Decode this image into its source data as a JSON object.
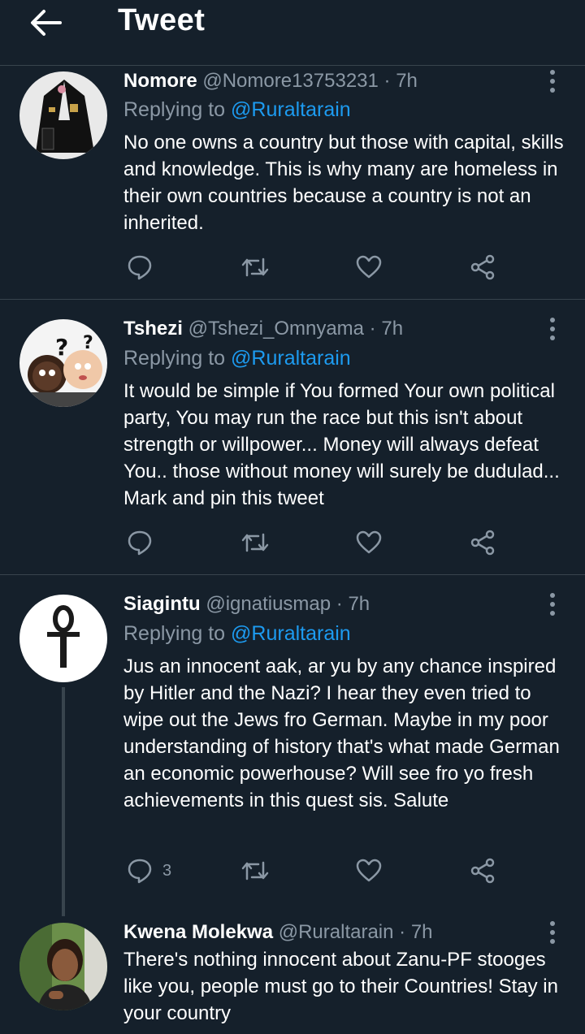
{
  "header": {
    "title": "Tweet"
  },
  "tweets": [
    {
      "name": "Nomore",
      "handle": "@Nomore13753231",
      "time": "7h",
      "replying_prefix": "Replying to ",
      "replying_to": "@Ruraltarain",
      "text": "No one owns a country but those with capital, skills and knowledge. This is why many are homeless in their own countries because a country is not an inherited.",
      "reply_count": ""
    },
    {
      "name": "Tshezi",
      "handle": "@Tshezi_Omnyama",
      "time": "7h",
      "replying_prefix": "Replying to ",
      "replying_to": "@Ruraltarain",
      "text": "It would be simple if You formed Your own political party, You may run the race but this isn't about strength or willpower... Money will always defeat You.. those without money will surely be dudulad... Mark and pin this tweet",
      "reply_count": ""
    },
    {
      "name": "Siagintu",
      "handle": "@ignatiusmap",
      "time": "7h",
      "replying_prefix": "Replying to ",
      "replying_to": "@Ruraltarain",
      "text": "Jus an innocent aak, ar yu by any chance inspired by Hitler and the Nazi? I hear they even tried to wipe out the Jews fro German. Maybe in my poor understanding of history that's what made German an economic powerhouse? Will see fro yo fresh achievements in this quest sis. Salute",
      "reply_count": "3"
    },
    {
      "name": "Kwena Molekwa",
      "handle": "@Ruraltarain",
      "time": "7h",
      "text": "There's nothing innocent about Zanu-PF stooges like you, people must go to their Countries! Stay in your country"
    }
  ],
  "separator": " · ",
  "colors": {
    "background": "#15202b",
    "divider": "#38444d",
    "secondary_text": "#8b98a5",
    "accent": "#1d9bf0"
  },
  "icons": [
    "back-arrow-icon",
    "more-vertical-icon",
    "reply-icon",
    "retweet-icon",
    "like-icon",
    "share-icon"
  ]
}
